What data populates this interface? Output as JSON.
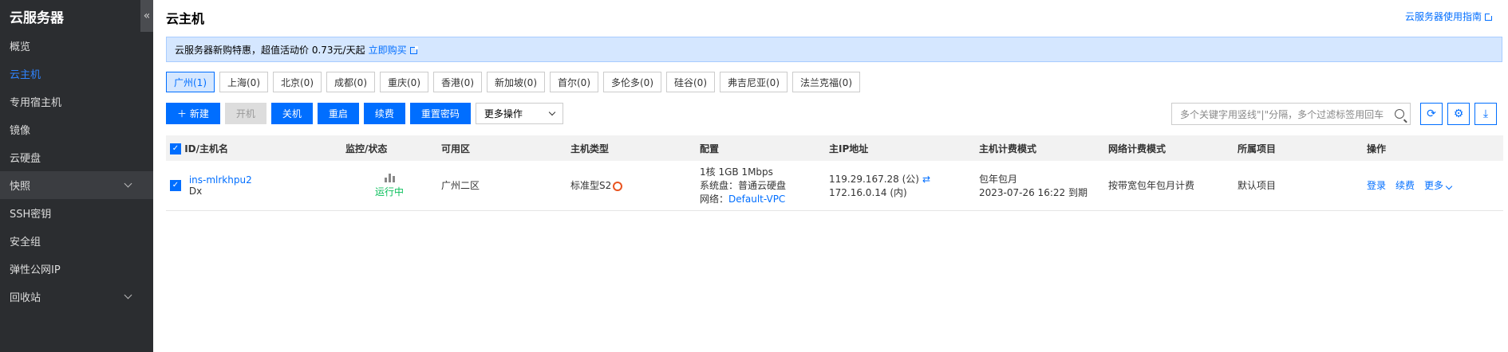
{
  "sidebar": {
    "title": "云服务器",
    "collapse_glyph": "«",
    "items": [
      {
        "label": "概览"
      },
      {
        "label": "云主机",
        "active": true
      },
      {
        "label": "专用宿主机"
      },
      {
        "label": "镜像"
      },
      {
        "label": "云硬盘"
      },
      {
        "label": "快照",
        "expandable": true
      },
      {
        "label": "SSH密钥"
      },
      {
        "label": "安全组"
      },
      {
        "label": "弹性公网IP"
      },
      {
        "label": "回收站",
        "expandable": true
      }
    ]
  },
  "header": {
    "title": "云主机",
    "guide_link": "云服务器使用指南"
  },
  "banner": {
    "text": "云服务器新购特惠，超值活动价 0.73元/天起",
    "link": "立即购买"
  },
  "regions": [
    "广州(1)",
    "上海(0)",
    "北京(0)",
    "成都(0)",
    "重庆(0)",
    "香港(0)",
    "新加坡(0)",
    "首尔(0)",
    "多伦多(0)",
    "硅谷(0)",
    "弗吉尼亚(0)",
    "法兰克福(0)"
  ],
  "toolbar": {
    "new": "＋ 新建",
    "start": "开机",
    "shutdown": "关机",
    "restart": "重启",
    "renew": "续费",
    "reset_password": "重置密码",
    "more_actions": "更多操作"
  },
  "search": {
    "placeholder": "多个关键字用竖线\"|\"分隔，多个过滤标签用回车"
  },
  "table": {
    "headers": [
      "ID/主机名",
      "监控/状态",
      "可用区",
      "主机类型",
      "配置",
      "主IP地址",
      "主机计费模式",
      "网络计费模式",
      "所属项目",
      "操作"
    ],
    "rows": [
      {
        "id": "ins-mlrkhpu2",
        "name": "Dx",
        "status": "运行中",
        "zone": "广州二区",
        "type": "标准型S2",
        "config_line1": "1核 1GB 1Mbps",
        "config_line2": "系统盘：普通云硬盘",
        "config_line3_label": "网络：",
        "config_line3_link": "Default-VPC",
        "ip_public": "119.29.167.28 (公)",
        "ip_private": "172.16.0.14 (内)",
        "billing": "包年包月",
        "expire": "2023-07-26 16:22 到期",
        "net_billing": "按带宽包年包月计费",
        "project": "默认项目",
        "op_login": "登录",
        "op_renew": "续费",
        "op_more": "更多"
      }
    ]
  },
  "colors": {
    "accent": "#006eff",
    "sidebar_bg": "#2b2d30",
    "running": "#0abf5b"
  }
}
